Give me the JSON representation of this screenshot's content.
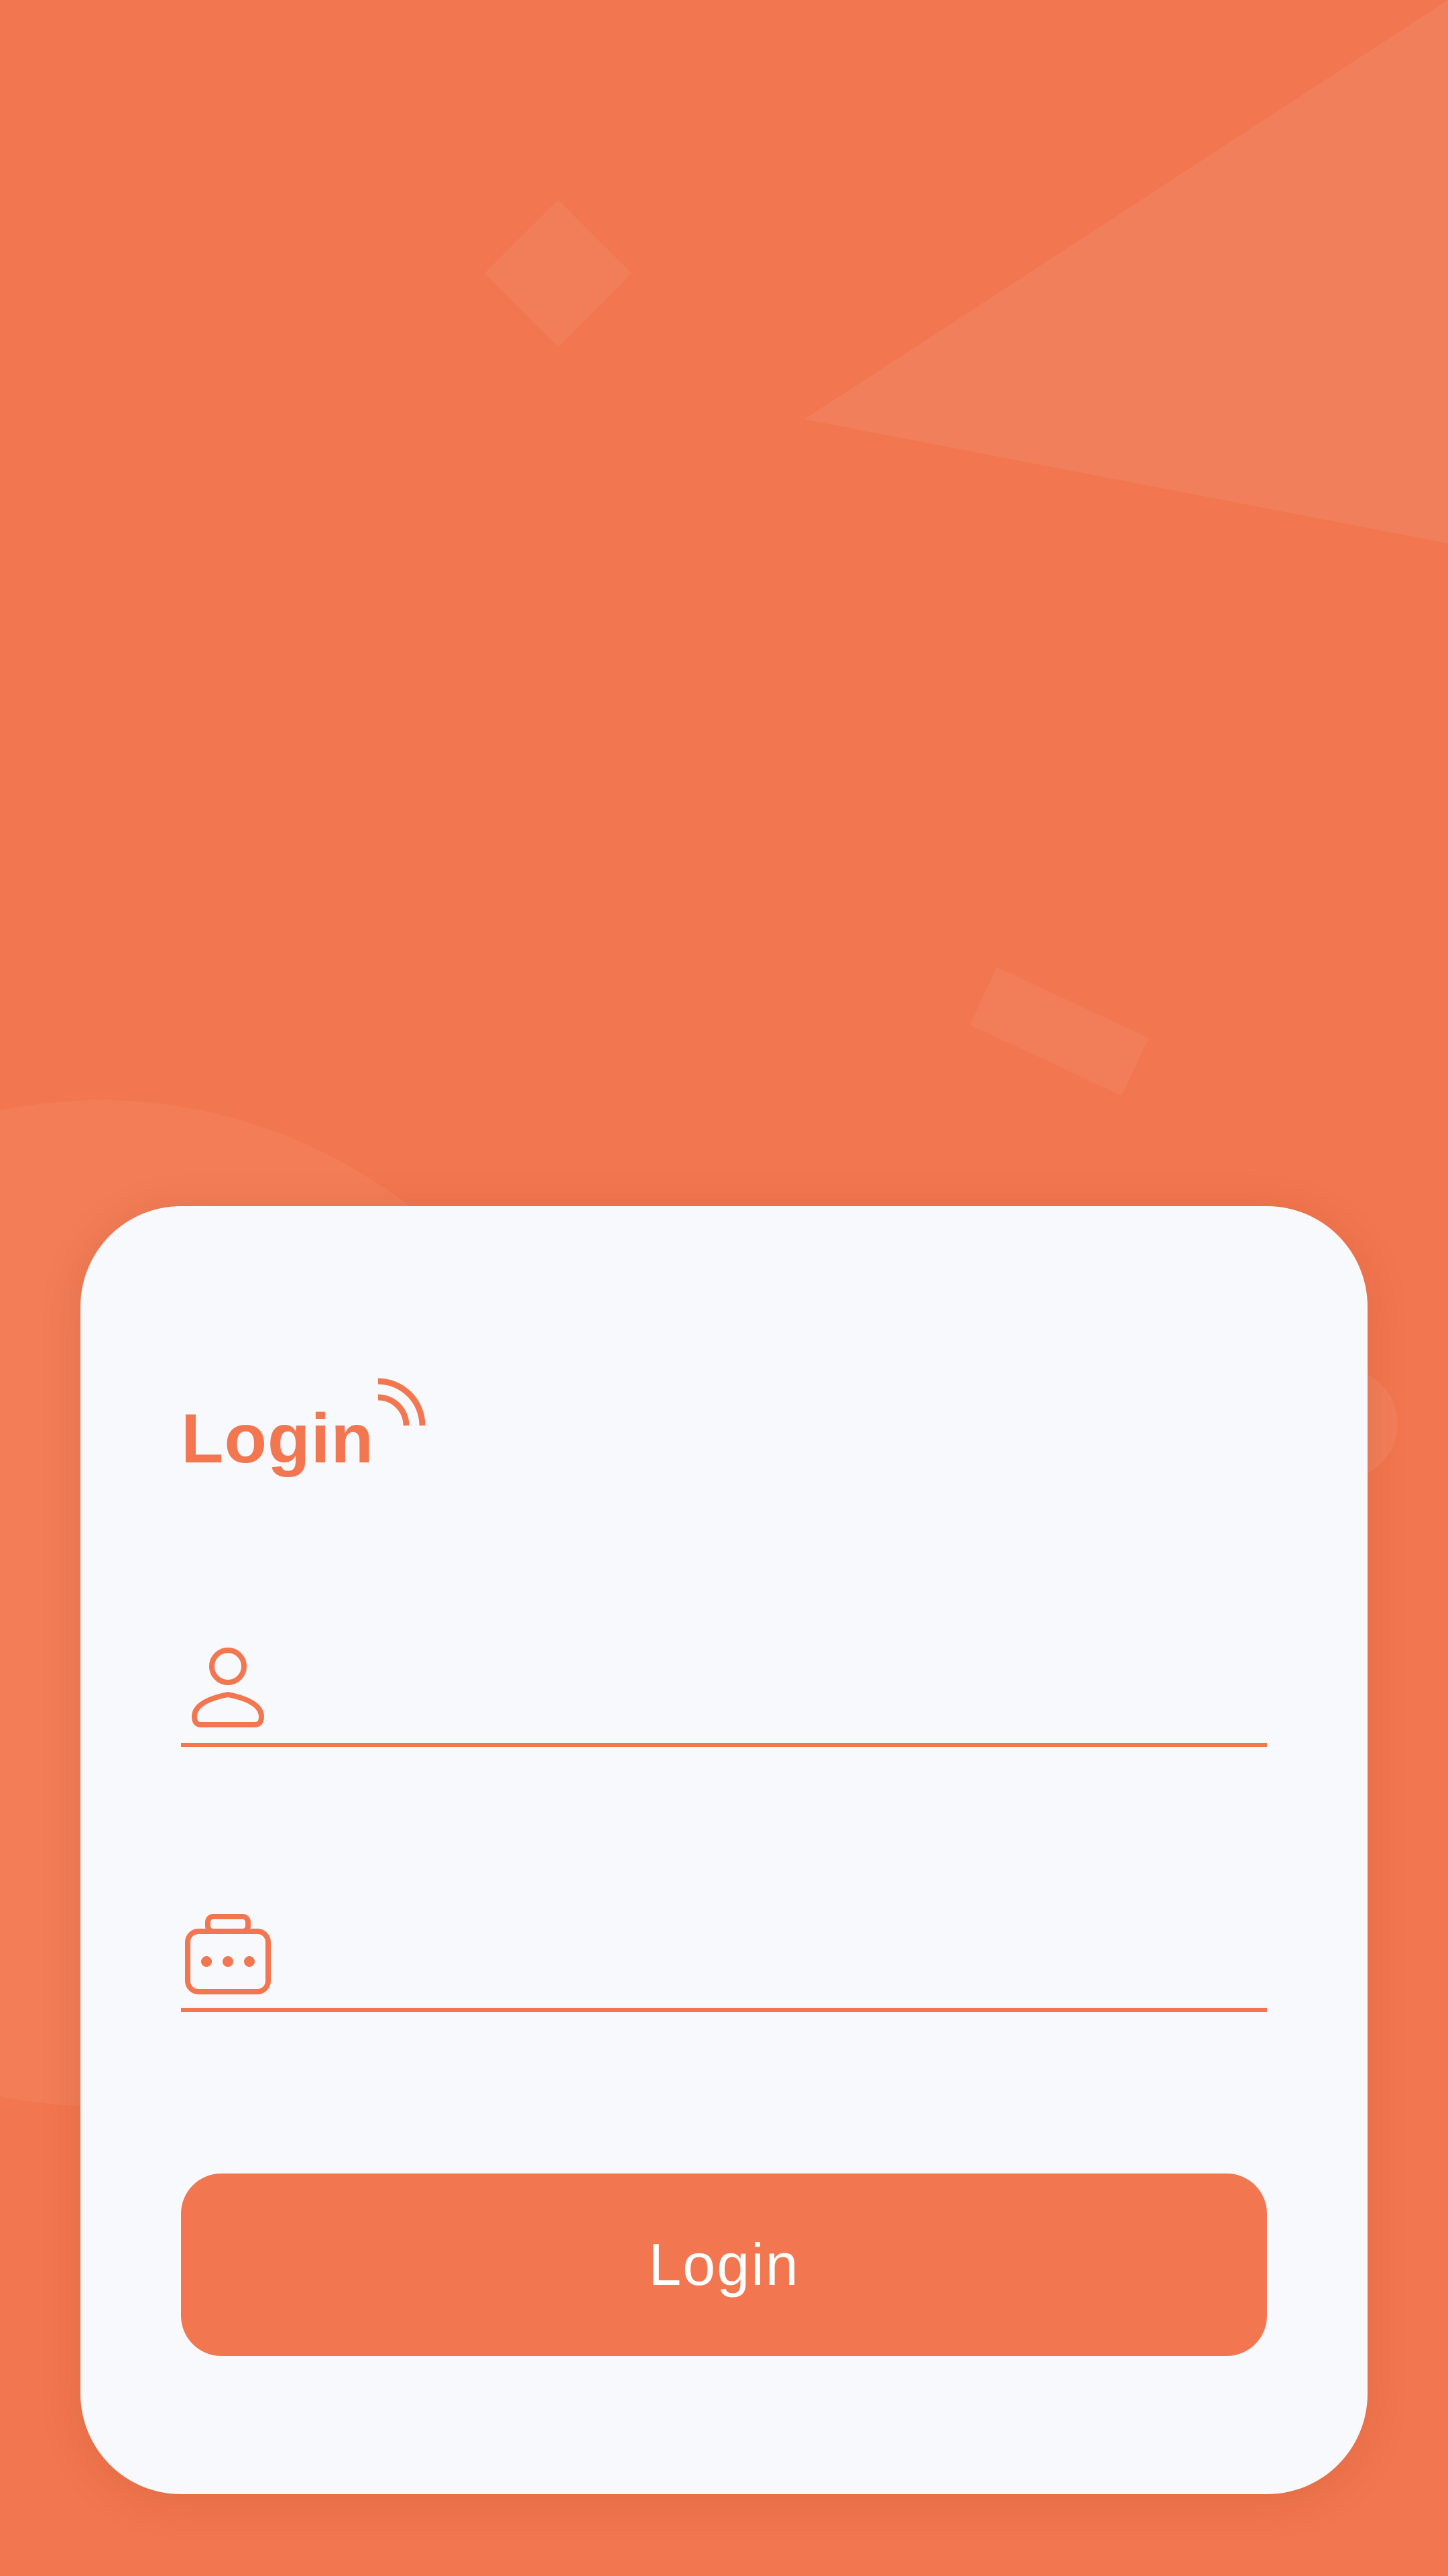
{
  "colors": {
    "background": "#F2764F",
    "card": "#F7F9FC",
    "accent": "#F2764F",
    "button_text": "#FFFFFF"
  },
  "card": {
    "title": "Login",
    "title_icon": "wifi-signal-icon"
  },
  "form": {
    "username": {
      "icon": "user-icon",
      "value": "",
      "placeholder": ""
    },
    "password": {
      "icon": "password-lock-icon",
      "value": "",
      "placeholder": ""
    },
    "submit_label": "Login"
  }
}
